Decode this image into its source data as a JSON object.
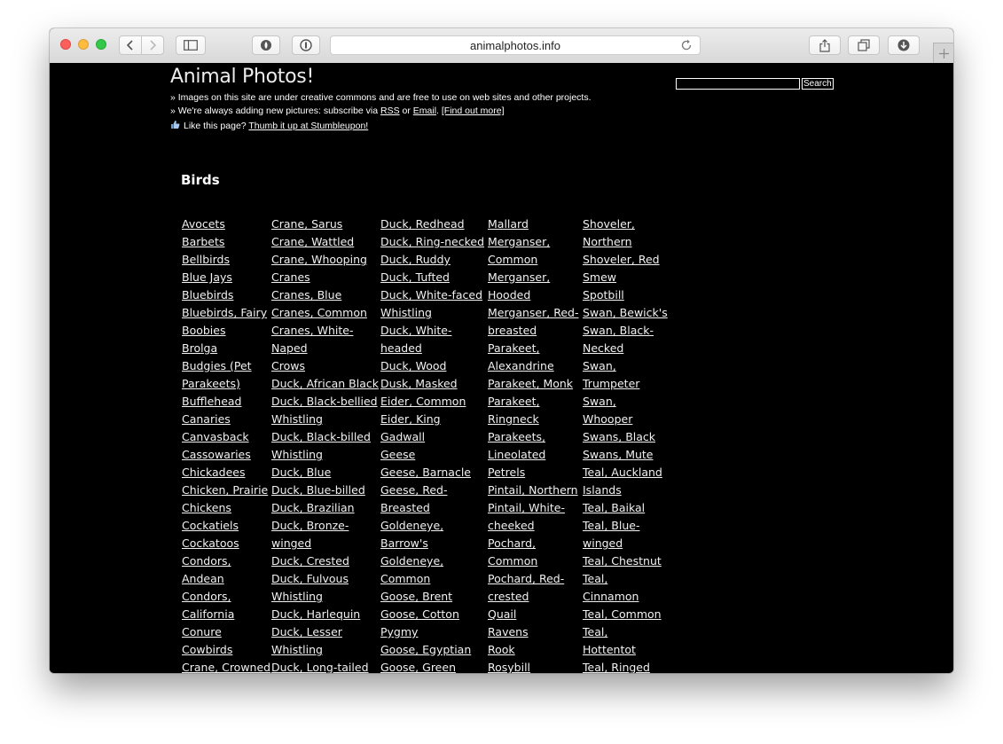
{
  "browser": {
    "url": "animalphotos.info"
  },
  "page": {
    "title": "Animal Photos!",
    "notes": {
      "line1": "» Images on this site are under creative commons and are free to use on web sites and other projects.",
      "line2_prefix": "» We're always adding new pictures: subscribe via ",
      "rss": "RSS",
      "or": " or ",
      "email": "Email",
      "sep": ". ",
      "find_out": "[Find out more]",
      "like_prefix": "Like this page? ",
      "thumb_link": "Thumb it up at Stumbleupon!"
    },
    "search": {
      "value": "",
      "button": "Search"
    },
    "section": "Birds",
    "columns": [
      [
        "Avocets",
        "Barbets",
        "Bellbirds",
        "Blue Jays",
        "Bluebirds",
        "Bluebirds, Fairy",
        "Boobies",
        "Brolga",
        "Budgies (Pet",
        "Parakeets)",
        "Bufflehead",
        "Canaries",
        "Canvasback",
        "Cassowaries",
        "Chickadees",
        "Chicken, Prairie",
        "Chickens",
        "Cockatiels",
        "Cockatoos",
        "Condors,",
        "Andean",
        "Condors,",
        "California",
        "Conure",
        "Cowbirds",
        "Crane, Crowned"
      ],
      [
        "Crane, Sarus",
        "Crane, Wattled",
        "Crane, Whooping",
        "Cranes",
        "Cranes, Blue",
        "Cranes, Common",
        "Cranes, White-",
        "Naped",
        "Crows",
        "Duck, African Black",
        "Duck, Black-bellied",
        "Whistling",
        "Duck, Black-billed",
        "Whistling",
        "Duck, Blue",
        "Duck, Blue-billed",
        "Duck, Brazilian",
        "Duck, Bronze-",
        "winged",
        "Duck, Crested",
        "Duck, Fulvous",
        "Whistling",
        "Duck, Harlequin",
        "Duck, Lesser",
        "Whistling",
        "Duck, Long-tailed"
      ],
      [
        "Duck, Redhead",
        "Duck, Ring-necked",
        "Duck, Ruddy",
        "Duck, Tufted",
        "Duck, White-faced",
        "Whistling",
        "Duck, White-",
        "headed",
        "Duck, Wood",
        "Dusk, Masked",
        "Eider, Common",
        "Eider, King",
        "Gadwall",
        "Geese",
        "Geese, Barnacle",
        "Geese, Red-",
        "Breasted",
        "Goldeneye,",
        "Barrow's",
        "Goldeneye,",
        "Common",
        "Goose, Brent",
        "Goose, Cotton",
        "Pygmy",
        "Goose, Egyptian",
        "Goose, Green"
      ],
      [
        "Mallard",
        "Merganser,",
        "Common",
        "Merganser,",
        "Hooded",
        "Merganser, Red-",
        "breasted",
        "Parakeet,",
        "Alexandrine",
        "Parakeet, Monk",
        "Parakeet,",
        "Ringneck",
        "Parakeets,",
        "Lineolated",
        "Petrels",
        "Pintail, Northern",
        "Pintail, White-",
        "cheeked",
        "Pochard,",
        "Common",
        "Pochard, Red-",
        "crested",
        "Quail",
        "Ravens",
        "Rook",
        "Rosybill"
      ],
      [
        "Shoveler,",
        "Northern",
        "Shoveler, Red",
        "Smew",
        "Spotbill",
        "Swan, Bewick's",
        "Swan, Black-",
        "Necked",
        "Swan,",
        "Trumpeter",
        "Swan,",
        "Whooper",
        "Swans, Black",
        "Swans, Mute",
        "Teal, Auckland",
        "Islands",
        "Teal, Baikal",
        "Teal, Blue-",
        "winged",
        "Teal, Chestnut",
        "Teal,",
        "Cinnamon",
        "Teal, Common",
        "Teal,",
        "Hottentot",
        "Teal, Ringed"
      ]
    ]
  }
}
